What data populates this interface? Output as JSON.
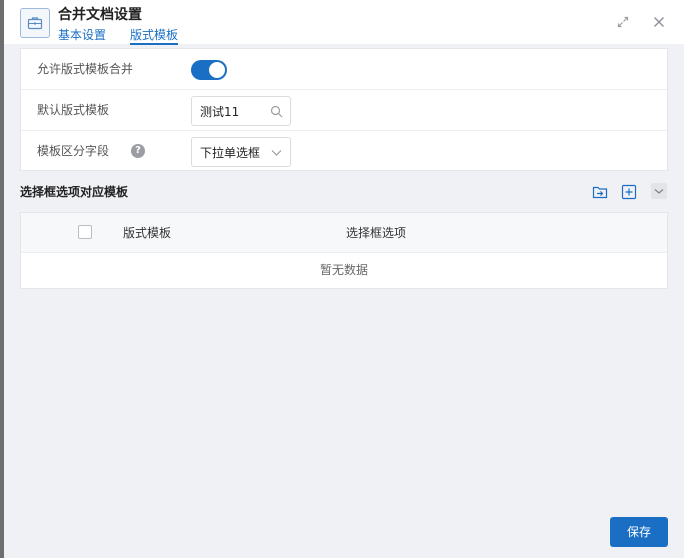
{
  "header": {
    "title": "合并文档设置",
    "tabs": [
      {
        "label": "基本设置",
        "active": false
      },
      {
        "label": "版式模板",
        "active": true
      }
    ]
  },
  "settings": {
    "rows": [
      {
        "label": "允许版式模板合并",
        "type": "toggle",
        "value": true
      },
      {
        "label": "默认版式模板",
        "type": "search",
        "value": "测试11"
      },
      {
        "label": "模板区分字段",
        "type": "select",
        "value": "下拉单选框",
        "help": "?"
      }
    ]
  },
  "section": {
    "title": "选择框选项对应模板",
    "columns": [
      "版式模板",
      "选择框选项"
    ],
    "empty_text": "暂无数据"
  },
  "footer": {
    "save_label": "保存"
  },
  "colors": {
    "accent": "#1a6fc4",
    "background": "#f0f1f5"
  },
  "icons": {
    "app": "briefcase-icon",
    "expand": "expand-icon",
    "close": "close-icon",
    "search": "search-icon",
    "dropdown": "chevron-down-icon",
    "import": "import-folder-icon",
    "add": "add-square-icon",
    "collapse": "chevron-down-icon",
    "help": "help-icon"
  }
}
